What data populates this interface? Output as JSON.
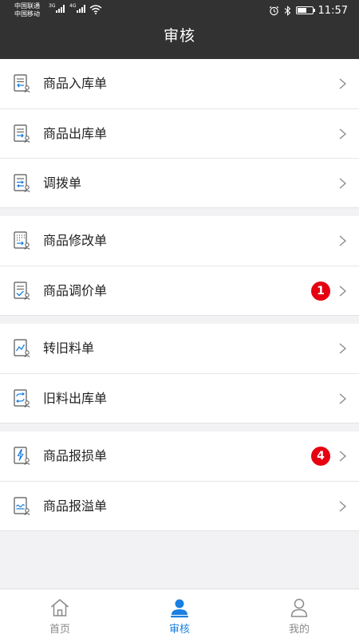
{
  "status_bar": {
    "carrier1": "中国联通",
    "carrier2": "中国移动",
    "net1": "3G",
    "net2": "4G",
    "time": "11:57"
  },
  "header": {
    "title": "审核"
  },
  "colors": {
    "header_bg": "#323232",
    "badge": "#e60012",
    "accent": "#1a7fe0",
    "icon_blue": "#1a7fe0"
  },
  "groups": [
    {
      "items": [
        {
          "label": "商品入库单",
          "icon": "stock-in-doc-icon"
        },
        {
          "label": "商品出库单",
          "icon": "stock-out-doc-icon"
        },
        {
          "label": "调拨单",
          "icon": "transfer-doc-icon"
        }
      ]
    },
    {
      "items": [
        {
          "label": "商品修改单",
          "icon": "edit-doc-icon"
        },
        {
          "label": "商品调价单",
          "icon": "price-adjust-doc-icon",
          "badge": "1"
        }
      ]
    },
    {
      "items": [
        {
          "label": "转旧料单",
          "icon": "old-material-doc-icon"
        },
        {
          "label": "旧料出库单",
          "icon": "old-material-out-doc-icon"
        }
      ]
    },
    {
      "items": [
        {
          "label": "商品报损单",
          "icon": "loss-report-doc-icon",
          "badge": "4"
        },
        {
          "label": "商品报溢单",
          "icon": "surplus-report-doc-icon"
        }
      ]
    }
  ],
  "tabbar": [
    {
      "label": "首页",
      "icon": "home-icon",
      "active": false
    },
    {
      "label": "审核",
      "icon": "audit-person-icon",
      "active": true
    },
    {
      "label": "我的",
      "icon": "profile-icon",
      "active": false
    }
  ]
}
